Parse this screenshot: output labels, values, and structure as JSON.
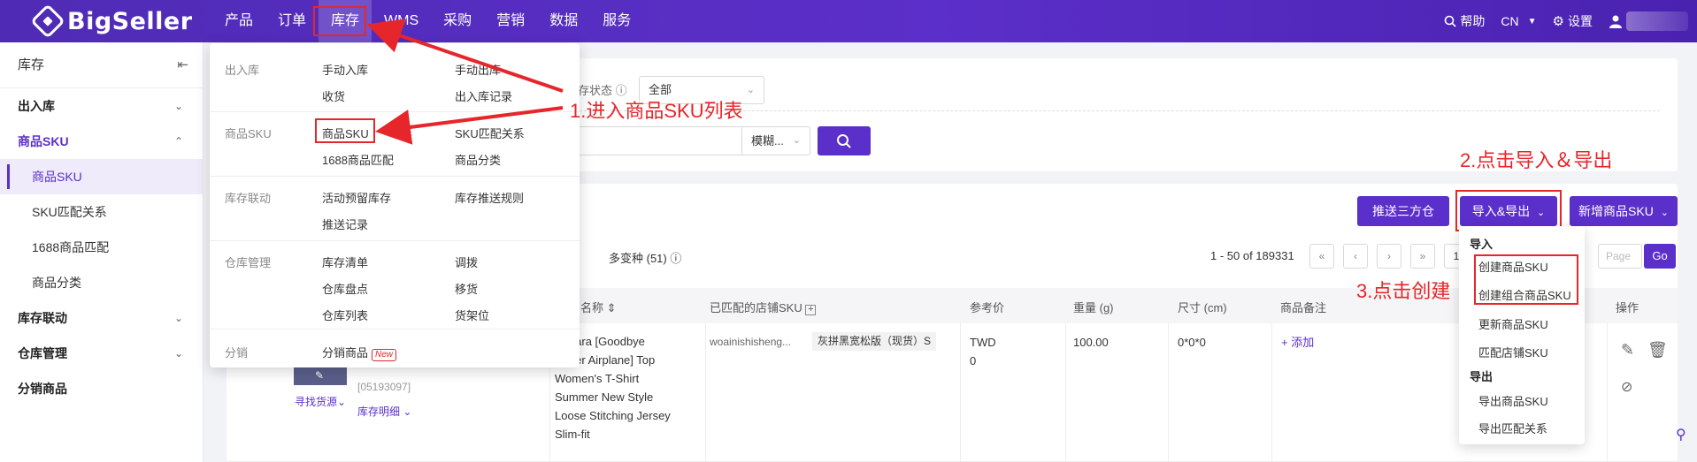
{
  "brand": {
    "name": "BigSeller",
    "accent": "#5b2fc9",
    "annotation_color": "#e6262a"
  },
  "nav": {
    "items": [
      "产品",
      "订单",
      "库存",
      "WMS",
      "采购",
      "营销",
      "数据",
      "服务"
    ]
  },
  "top_right": {
    "help": "帮助",
    "lang": "CN",
    "settings": "设置"
  },
  "sidebar": {
    "title": "库存",
    "groups": [
      {
        "label": "出入库"
      },
      {
        "label": "商品SKU",
        "children": [
          "商品SKU",
          "SKU匹配关系",
          "1688商品匹配",
          "商品分类"
        ]
      },
      {
        "label": "库存联动"
      },
      {
        "label": "仓库管理"
      },
      {
        "label": "分销商品"
      }
    ]
  },
  "filters": {
    "status_label": "库存状态",
    "status_value": "全部",
    "search_mode": "模糊..."
  },
  "toolbar": {
    "push_btn": "推送三方仓",
    "import_export_btn": "导入&导出",
    "add_btn": "新增商品SKU"
  },
  "list": {
    "variant_label": "多变种 (51)",
    "pager_info": "1 - 50 of 189331",
    "page_current": "1",
    "page_placeholder": "Page",
    "go": "Go"
  },
  "table": {
    "headers": [
      "名称",
      "已匹配的店铺SKU",
      "参考价",
      "重量 (g)",
      "尺寸 (cm)",
      "商品备注",
      "操作"
    ],
    "row": {
      "find_source": "寻找货源",
      "sku_code": "[05193097]",
      "stock_detail": "库存明细",
      "title_lines": [
        "Sahara [Goodbye",
        "Paper Airplane] Top",
        "Women's T-Shirt",
        "Summer New Style",
        "Loose Stitching Jersey",
        "Slim-fit"
      ],
      "store_sku": "woainishisheng...",
      "variant_tag": "灰拼黑宽松版（现货）S",
      "currency": "TWD",
      "price": "0",
      "weight": "100.00",
      "size": "0*0*0",
      "add_note": "+ 添加"
    }
  },
  "menu": {
    "sections": [
      {
        "category": "出入库",
        "items": [
          "手动入库",
          "手动出库",
          "收货",
          "出入库记录"
        ]
      },
      {
        "category": "商品SKU",
        "items": [
          "商品SKU",
          "SKU匹配关系",
          "1688商品匹配",
          "商品分类"
        ]
      },
      {
        "category": "库存联动",
        "items": [
          "活动预留库存",
          "库存推送规则",
          "推送记录"
        ]
      },
      {
        "category": "仓库管理",
        "items": [
          "库存清单",
          "调拨",
          "仓库盘点",
          "移货",
          "仓库列表",
          "货架位"
        ]
      },
      {
        "category": "分销",
        "items": [
          "分销商品"
        ],
        "badge": "New"
      }
    ]
  },
  "ie_menu": {
    "import_label": "导入",
    "import_items": [
      "创建商品SKU",
      "创建组合商品SKU",
      "更新商品SKU",
      "匹配店铺SKU"
    ],
    "export_label": "导出",
    "export_items": [
      "导出商品SKU",
      "导出匹配关系"
    ]
  },
  "annotations": {
    "step1": "1.进入商品SKU列表",
    "step2": "2.点击导入＆导出",
    "step3": "3.点击创建"
  }
}
